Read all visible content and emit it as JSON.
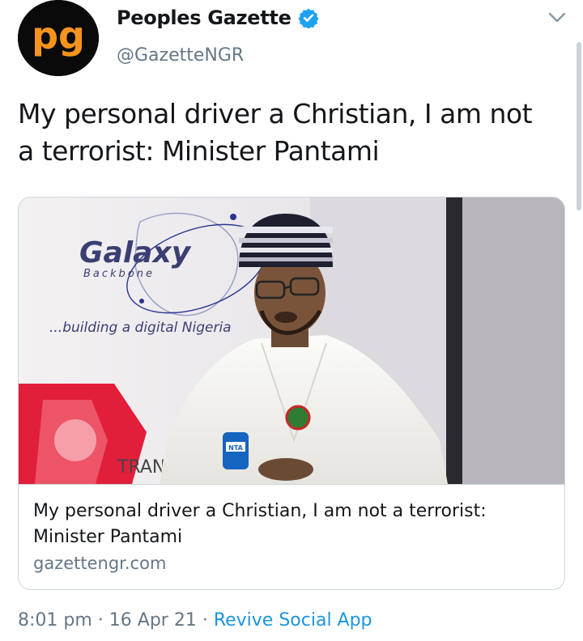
{
  "author": {
    "display_name": "Peoples Gazette",
    "handle": "@GazetteNGR",
    "verified": true,
    "avatar_icon": "pg-logo-icon",
    "avatar_text": "pg"
  },
  "tweet": {
    "text": "My personal driver a Christian, I am not a terrorist: Minister Pantami"
  },
  "link_card": {
    "title": "My personal driver a Christian, I am not a terrorist: Minister Pantami",
    "domain": "gazettengr.com",
    "image": {
      "banner_brand": "Galaxy",
      "banner_sub": "Backbone",
      "banner_tagline": "...building a digital Nigeria",
      "banner_word": "TRANS",
      "mic_label": "NTA"
    }
  },
  "meta": {
    "time": "8:01 pm",
    "sep1": " · ",
    "date": "16 Apr 21",
    "sep2": " · ",
    "source": "Revive Social App"
  },
  "colors": {
    "brand_orange": "#f7941d",
    "verified_blue": "#1da1f2",
    "link_blue": "#1b95e0",
    "muted_gray": "#657786"
  }
}
